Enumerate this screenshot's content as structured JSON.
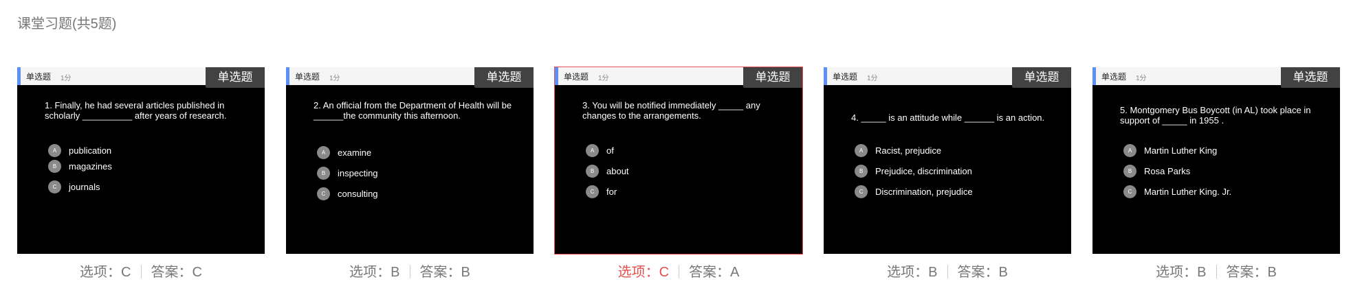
{
  "section_title": "课堂习题(共5题)",
  "accent_color": "#5b8ff9",
  "wrong_color": "#e5504f",
  "cards": [
    {
      "header_type": "单选题",
      "header_score": "1分",
      "badge": "单选题",
      "question": "1. Finally, he had several articles published in scholarly __________ after years of research.",
      "options": [
        {
          "letter": "A",
          "text": "publication"
        },
        {
          "letter": "B",
          "text": "magazines"
        },
        {
          "letter": "C",
          "text": "journals"
        }
      ],
      "selected_label": "选项：C",
      "answer_label": "答案：C",
      "is_wrong": false
    },
    {
      "header_type": "单选题",
      "header_score": "1分",
      "badge": "单选题",
      "question": "2. An official from the Department of Health will be ______the community this afternoon.",
      "options": [
        {
          "letter": "A",
          "text": "examine"
        },
        {
          "letter": "B",
          "text": "inspecting"
        },
        {
          "letter": "C",
          "text": "consulting"
        }
      ],
      "selected_label": "选项：B",
      "answer_label": "答案：B",
      "is_wrong": false
    },
    {
      "header_type": "单选题",
      "header_score": "1分",
      "badge": "单选题",
      "question": "3. You will be notified immediately _____ any changes to the arrangements.",
      "options": [
        {
          "letter": "A",
          "text": "of"
        },
        {
          "letter": "B",
          "text": "about"
        },
        {
          "letter": "C",
          "text": "for"
        }
      ],
      "selected_label": "选项：C",
      "answer_label": "答案：A",
      "is_wrong": true
    },
    {
      "header_type": "单选题",
      "header_score": "1分",
      "badge": "单选题",
      "question": "4. _____ is an attitude while ______ is an action.",
      "options": [
        {
          "letter": "A",
          "text": "Racist, prejudice"
        },
        {
          "letter": "B",
          "text": "Prejudice, discrimination"
        },
        {
          "letter": "C",
          "text": "Discrimination, prejudice"
        }
      ],
      "selected_label": "选项：B",
      "answer_label": "答案：B",
      "is_wrong": false
    },
    {
      "header_type": "单选题",
      "header_score": "1分",
      "badge": "单选题",
      "question": "5. Montgomery Bus Boycott (in AL) took place in support of _____ in 1955 .",
      "options": [
        {
          "letter": "A",
          "text": "Martin Luther King"
        },
        {
          "letter": "B",
          "text": "Rosa Parks"
        },
        {
          "letter": "C",
          "text": "Martin Luther King. Jr."
        }
      ],
      "selected_label": "选项：B",
      "answer_label": "答案：B",
      "is_wrong": false
    }
  ]
}
